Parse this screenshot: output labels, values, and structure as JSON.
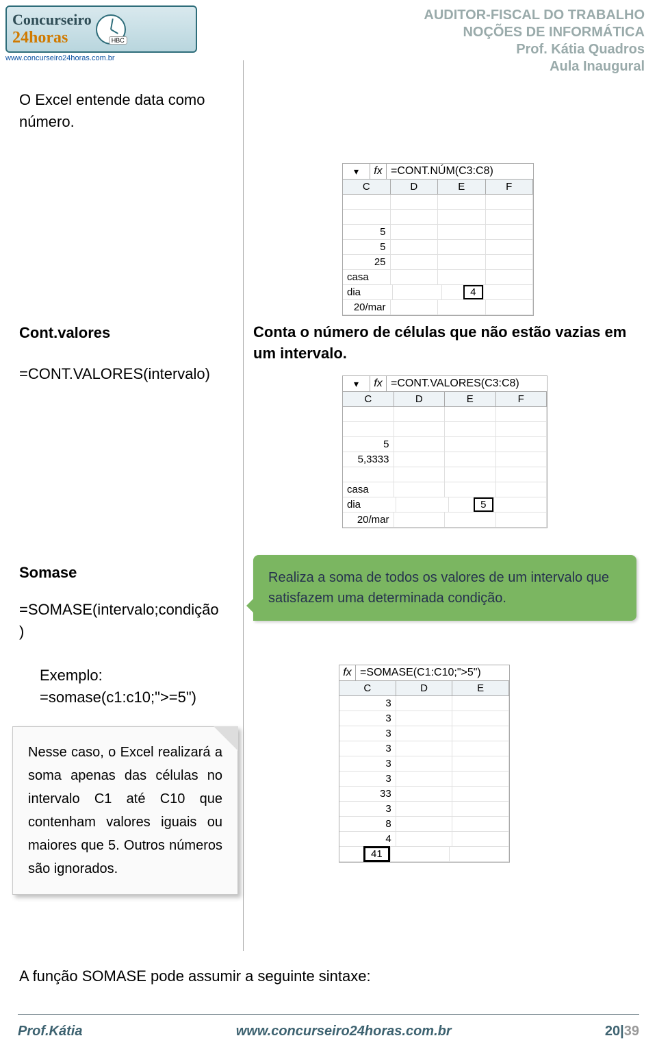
{
  "header": {
    "logo_line1": "Concurseiro",
    "logo_line2": "24horas",
    "logo_tag": "HBC",
    "logo_url": "www.concurseiro24horas.com.br",
    "line1": "AUDITOR-FISCAL DO TRABALHO",
    "line2": "NOÇÕES DE INFORMÁTICA",
    "line3": "Prof. Kátia Quadros",
    "line4": "Aula Inaugural"
  },
  "intro_para": "O Excel entende data como número.",
  "excel1": {
    "formula": "=CONT.NÚM(C3:C8)",
    "fx": "fx",
    "dropdown": "▾",
    "cols": [
      "C",
      "D",
      "E",
      "F"
    ],
    "rows": [
      [
        "",
        "",
        "",
        ""
      ],
      [
        "",
        "",
        "",
        ""
      ],
      [
        "5",
        "",
        "",
        ""
      ],
      [
        "5",
        "",
        "",
        ""
      ],
      [
        "25",
        "",
        "",
        ""
      ],
      [
        "casa",
        "",
        "",
        ""
      ],
      [
        "dia",
        "",
        "4",
        ""
      ],
      [
        "20/mar",
        "",
        "",
        ""
      ]
    ],
    "result": "4"
  },
  "contvalores": {
    "title": "Cont.valores",
    "syntax": "=CONT.VALORES(intervalo)",
    "desc": "Conta o número de células que não estão vazias em um intervalo."
  },
  "excel2": {
    "formula": "=CONT.VALORES(C3:C8)",
    "fx": "fx",
    "dropdown": "▾",
    "cols": [
      "C",
      "D",
      "E",
      "F"
    ],
    "rows": [
      [
        "",
        "",
        "",
        ""
      ],
      [
        "",
        "",
        "",
        ""
      ],
      [
        "5",
        "",
        "",
        ""
      ],
      [
        "5,3333",
        "",
        "",
        ""
      ],
      [
        "",
        "",
        "",
        ""
      ],
      [
        "casa",
        "",
        "",
        ""
      ],
      [
        "dia",
        "",
        "5",
        ""
      ],
      [
        "20/mar",
        "",
        "",
        ""
      ]
    ],
    "result": "5"
  },
  "somase": {
    "title": "Somase",
    "syntax_line1": "=SOMASE(intervalo;condição",
    "syntax_line2": ")",
    "callout": "Realiza a soma de todos os valores de um intervalo que satisfazem uma determinada condição.",
    "example_label": "Exemplo:",
    "example_code": "=somase(c1:c10;\">=5\")",
    "note": "Nesse caso, o Excel realizará a soma apenas das células no intervalo C1 até C10 que contenham valores iguais ou maiores que 5. Outros números são ignorados."
  },
  "excel3": {
    "formula": "=SOMASE(C1:C10;\">5\")",
    "fx": "fx",
    "cols": [
      "C",
      "D",
      "E"
    ],
    "values": [
      "3",
      "3",
      "3",
      "3",
      "3",
      "3",
      "33",
      "3",
      "8",
      "4",
      "41"
    ]
  },
  "bottom": "A função SOMASE pode assumir a seguinte sintaxe:",
  "footer": {
    "name": "Prof.Kátia",
    "url": "www.concurseiro24horas.com.br",
    "page_cur": "20",
    "page_sep": "|",
    "page_total": "39"
  }
}
